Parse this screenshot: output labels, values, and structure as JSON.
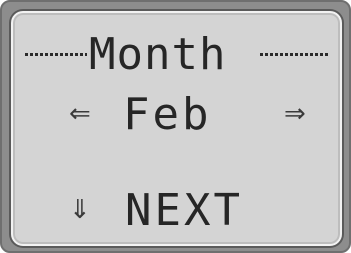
{
  "screen": {
    "title": "Month",
    "selected_month": "Feb",
    "prev_icon": "left-arrow-icon",
    "next_icon": "right-arrow-icon",
    "action_icon": "down-arrow-icon",
    "action_label": "NEXT",
    "colors": {
      "lcd_background": "#d4d4d4",
      "lcd_text": "#262626",
      "bezel": "#8d8d8d"
    }
  }
}
